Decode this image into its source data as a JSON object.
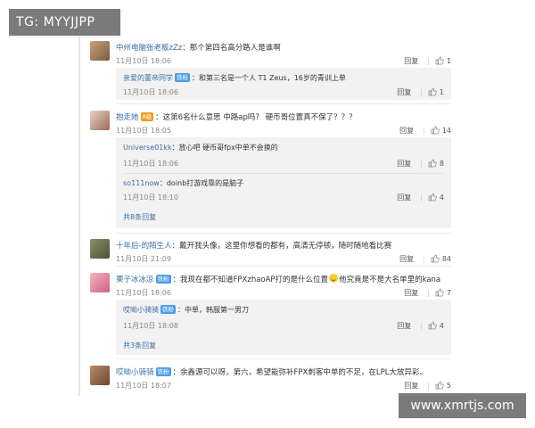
{
  "watermark_top": "TG: MYYJJPP",
  "watermark_bottom": "www.xmrtjs.com",
  "labels": {
    "reply": "回复",
    "badge_fan": "铁粉"
  },
  "comments": [
    {
      "user": "中州电脑张老板zZz",
      "text": "：那个第四名高分路人是谁啊",
      "time": "11月10日 18:06",
      "likes": "1",
      "replies": [
        {
          "user": "亲爱的董帝同学",
          "badge": true,
          "text": "：和第三名是一个人 T1 Zeus，16岁的青训上单",
          "time": "11月10日 18:06",
          "likes": "1"
        }
      ]
    },
    {
      "user": "抱走她",
      "badge_orange": "8级",
      "text": "：这第6名什么意思 中路ap吗？ 硬币哥位置真不保了？？？",
      "time": "11月10日 18:05",
      "likes": "14",
      "replies": [
        {
          "user": "Universe01kk",
          "text": "：放心吧 硬币哥fpx中单不会换的",
          "time": "11月10日 18:06",
          "likes": "8"
        },
        {
          "user": "so111now",
          "text": "：doinb打游戏靠的是脑子",
          "time": "11月10日 18:10",
          "likes": "4"
        }
      ],
      "more": "共8条回复"
    },
    {
      "user": "十年后-的陌生人",
      "text": "：戴开我头像，这里你想看的都有，高清无停顿，随时随地看比赛",
      "time": "11月10日 21:09",
      "likes": "84"
    },
    {
      "user": "栗子冰冰凉",
      "badge": true,
      "text_a": "：我现在都不知道FPXzhaoAP打的是什么位置",
      "text_b": "他究竟是不是大名单里的kana",
      "time": "11月10日 18:06",
      "likes": "7",
      "replies": [
        {
          "user": "哎呦小骑骑",
          "badge": true,
          "text": "：中单，韩服第一男刀",
          "time": "11月10日 18:08",
          "likes": "4"
        }
      ],
      "more": "共3条回复"
    },
    {
      "user": "哎呦小骑骑",
      "badge": true,
      "text": "：余鑫源可以呀，第六，希望能弥补FPX刺客中单的不足，在LPL大放异彩。",
      "time": "11月10日 18:07",
      "likes": "5"
    }
  ],
  "colors": {
    "username": "#3a6ea5",
    "badge": "#4a9ee8",
    "reply_bg": "#f2f2f2"
  }
}
